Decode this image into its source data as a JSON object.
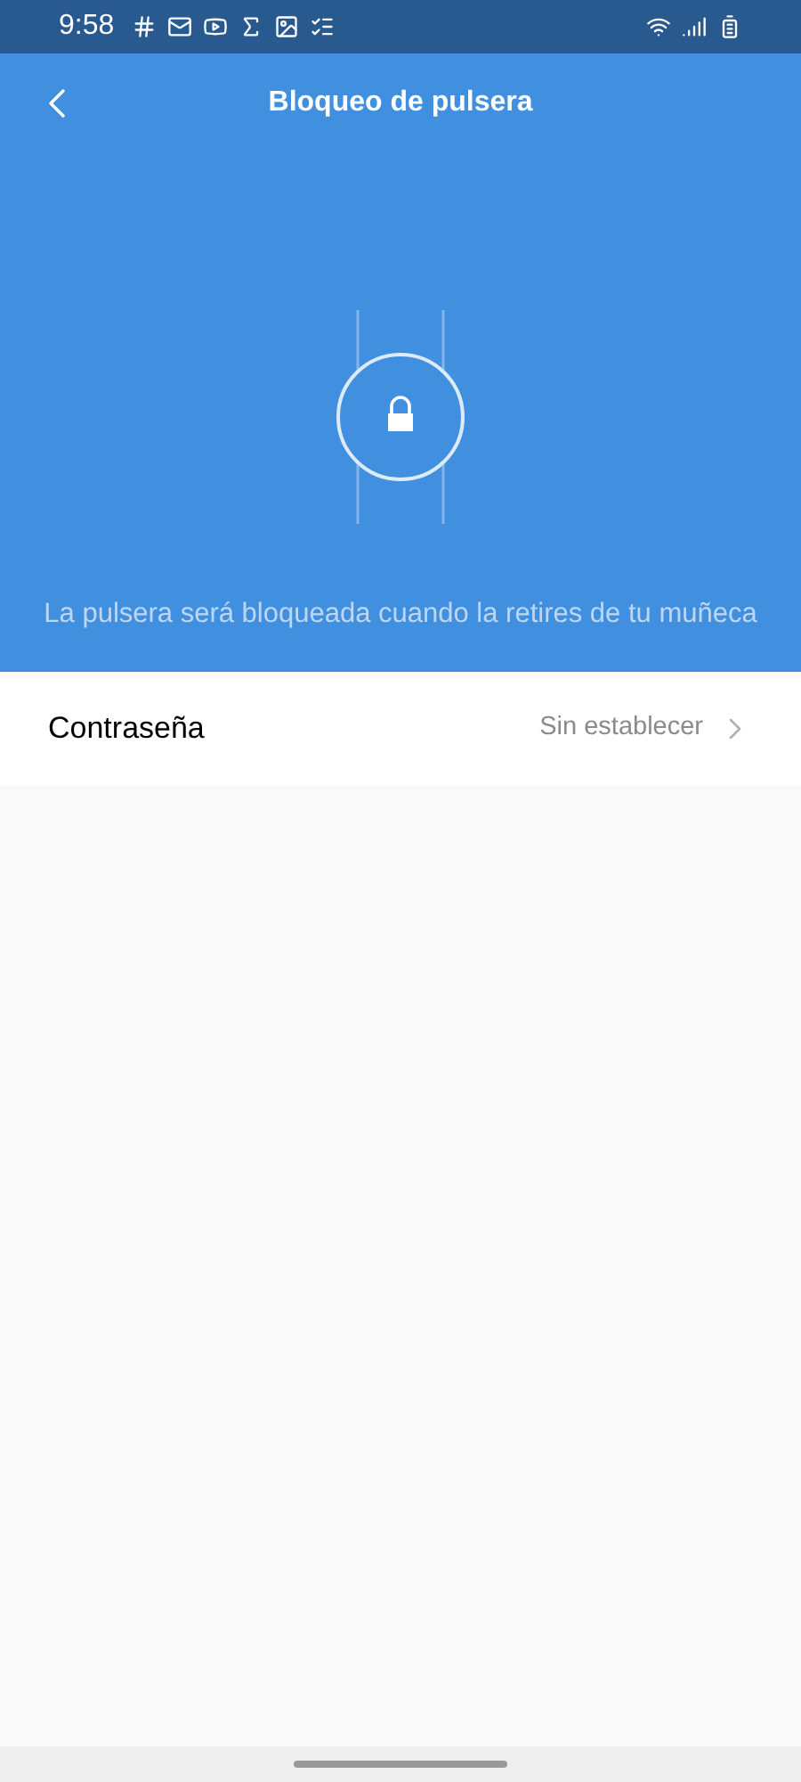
{
  "status_bar": {
    "time": "9:58"
  },
  "header": {
    "title": "Bloqueo de pulsera",
    "description": "La pulsera será bloqueada cuando la retires de tu muñeca"
  },
  "settings": [
    {
      "label": "Contraseña",
      "value": "Sin establecer"
    }
  ]
}
